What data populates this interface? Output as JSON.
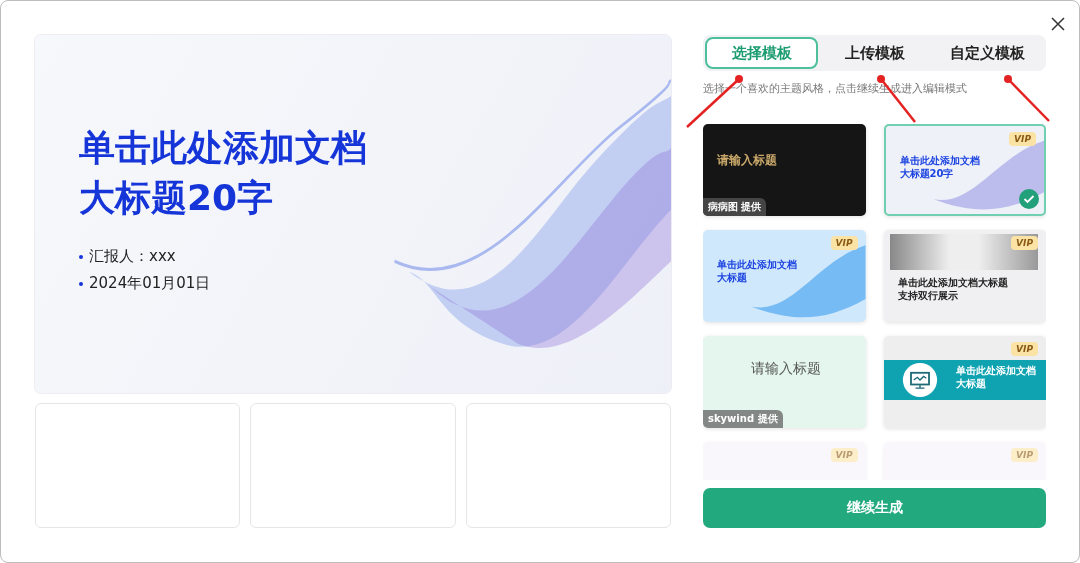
{
  "preview": {
    "title_lines": [
      "单击此处添加文档",
      "大标题20字"
    ],
    "bullets": [
      "汇报人：xxx",
      "2024年01月01日"
    ]
  },
  "tabs": [
    {
      "label": "选择模板",
      "selected": true
    },
    {
      "label": "上传模板",
      "selected": false
    },
    {
      "label": "自定义模板",
      "selected": false
    }
  ],
  "hint": "选择一个喜欢的主题风格，点击继续生成进入编辑模式",
  "templates": [
    {
      "kind": "dark",
      "title": [
        "请输入标题"
      ],
      "selected": false,
      "provider": "病病图 提供"
    },
    {
      "kind": "wave",
      "title": [
        "单击此处添加文档",
        "大标题20字"
      ],
      "badge": "VIP",
      "selected": true
    },
    {
      "kind": "blue",
      "title": [
        "单击此处添加文档",
        "大标题"
      ],
      "badge": "VIP",
      "selected": false
    },
    {
      "kind": "gray",
      "title": [
        "单击此处添加文档大标题",
        "支持双行展示"
      ],
      "badge": "VIP",
      "selected": false
    },
    {
      "kind": "kids",
      "title": [
        "请输入标题"
      ],
      "selected": false,
      "provider": "skywind 提供"
    },
    {
      "kind": "teal",
      "title": [
        "单击此处添加文档",
        "大标题"
      ],
      "badge": "VIP",
      "selected": false
    },
    {
      "kind": "faded",
      "badge": "VIP",
      "selected": false
    },
    {
      "kind": "faded",
      "badge": "VIP",
      "selected": false
    }
  ],
  "continue_button": "继续生成"
}
